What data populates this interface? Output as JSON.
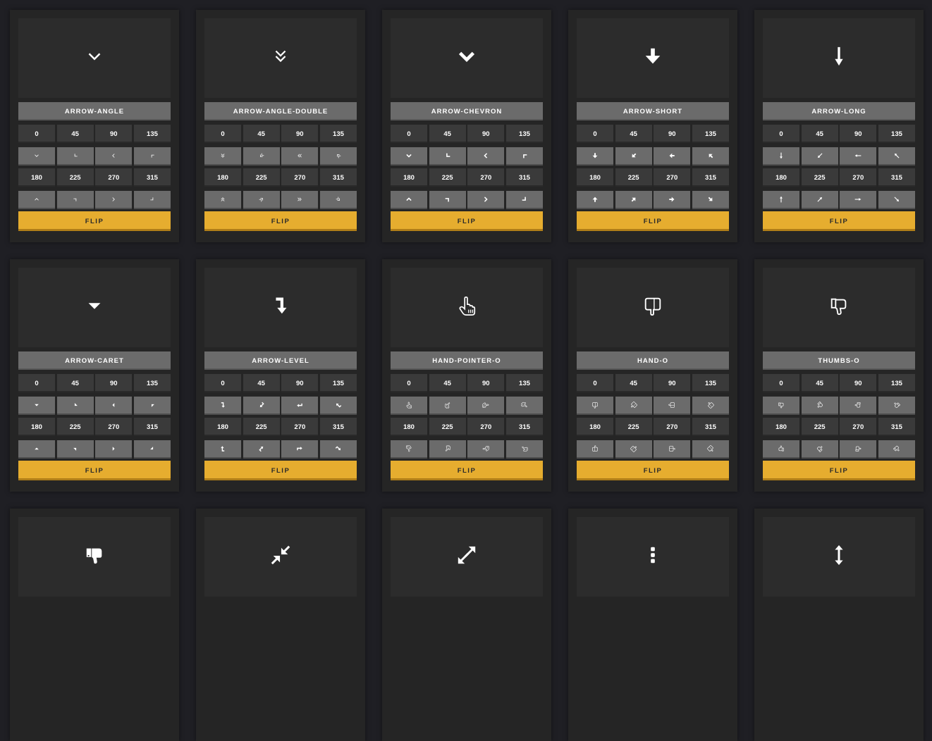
{
  "flip_label": "FLIP",
  "angles_top": [
    "0",
    "45",
    "90",
    "135"
  ],
  "angles_bottom": [
    "180",
    "225",
    "270",
    "315"
  ],
  "icons": [
    {
      "name": "ARROW-ANGLE",
      "glyph": "angle"
    },
    {
      "name": "ARROW-ANGLE-DOUBLE",
      "glyph": "angle-double"
    },
    {
      "name": "ARROW-CHEVRON",
      "glyph": "chevron"
    },
    {
      "name": "ARROW-SHORT",
      "glyph": "short"
    },
    {
      "name": "ARROW-LONG",
      "glyph": "long"
    },
    {
      "name": "ARROW-CARET",
      "glyph": "caret"
    },
    {
      "name": "ARROW-LEVEL",
      "glyph": "level"
    },
    {
      "name": "HAND-POINTER-O",
      "glyph": "pointer"
    },
    {
      "name": "HAND-O",
      "glyph": "hand"
    },
    {
      "name": "THUMBS-O",
      "glyph": "thumbs"
    },
    {
      "name": "",
      "glyph": "thumbs-solid"
    },
    {
      "name": "",
      "glyph": "compress"
    },
    {
      "name": "",
      "glyph": "expand"
    },
    {
      "name": "",
      "glyph": "ellipsis-v"
    },
    {
      "name": "",
      "glyph": "arrows-v"
    }
  ]
}
